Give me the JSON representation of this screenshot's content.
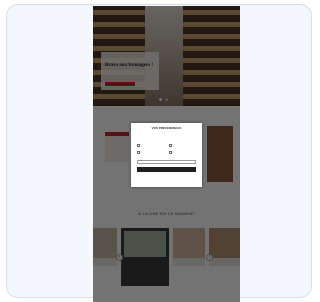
{
  "hero": {
    "title": "Bravo aux fromagers !",
    "small_text": "",
    "button_label": "",
    "slides_total": 2
  },
  "section": {
    "title": "À LA UNE EN CE MOMENT"
  },
  "modal": {
    "title": "VOS PRÉFÉRENCES",
    "text": "",
    "options": [
      {
        "label": ""
      },
      {
        "label": ""
      },
      {
        "label": ""
      },
      {
        "label": ""
      }
    ],
    "input_placeholder": "",
    "submit_label": "",
    "link_label": ""
  },
  "colors": {
    "accent": "#c3272d",
    "overlay": "#000000",
    "frame_border": "#d6dde6"
  }
}
